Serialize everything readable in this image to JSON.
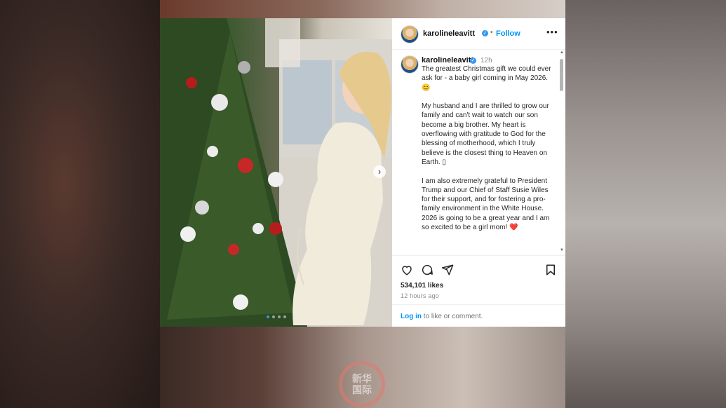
{
  "post": {
    "username": "karolineleavitt",
    "separator": "•",
    "follow_label": "Follow",
    "more_icon": "more-horizontal-icon",
    "verified_badge": "✓"
  },
  "caption": {
    "username": "karolineleavitt",
    "time": "12h",
    "text": "The greatest Christmas gift we could ever ask for - a baby girl coming in May 2026.😊\n\nMy husband and I are thrilled to grow our family and can't wait to watch our son become a big brother. My heart is overflowing with gratitude to God for the blessing of motherhood, which I truly believe is the closest thing to Heaven on Earth. ▯\n\nI am also extremely grateful to President Trump and our Chief of Staff Susie Wiles for their support, and for fostering a pro-family environment in the White House. 2026 is going to be a great year and I am so excited to be a girl mom! ❤️"
  },
  "actions": {
    "like_icon": "heart-icon",
    "comment_icon": "comment-icon",
    "share_icon": "send-icon",
    "save_icon": "bookmark-icon"
  },
  "stats": {
    "likes": "534,101 likes",
    "time_ago": "12 hours ago"
  },
  "footer": {
    "login_link": "Log in",
    "login_rest": " to like or comment."
  },
  "carousel": {
    "next_icon": "chevron-right-icon",
    "next_glyph": "›",
    "slide_count": 4,
    "active_slide": 1
  },
  "watermark": {
    "text": "新华\n国际"
  },
  "colors": {
    "link": "#0095f6",
    "verified": "#3897f0",
    "heart": "#e0245e"
  }
}
